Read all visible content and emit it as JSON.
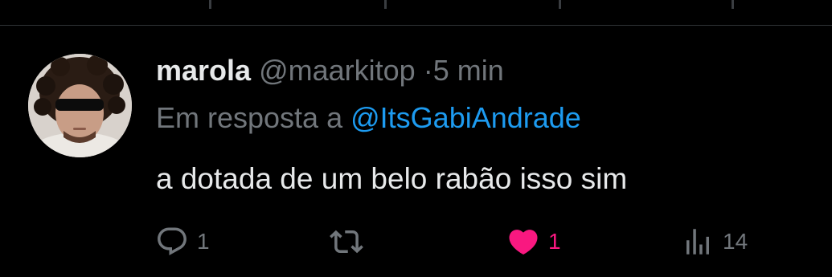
{
  "colors": {
    "background": "#000000",
    "divider": "#2f3336",
    "primary_text": "#e7e9ea",
    "secondary_text": "#71767b",
    "mention": "#1d9bf0",
    "like_active": "#f91880"
  },
  "tweet": {
    "author": {
      "display_name": "marola",
      "handle": "@maarkitop",
      "avatar_icon": "user-avatar-photo"
    },
    "separator": "·",
    "timestamp": "5 min",
    "reply_prefix": "Em resposta a",
    "reply_to": "@ItsGabiAndrade",
    "text": "a dotada de um belo rabão isso sim",
    "actions": {
      "reply": {
        "icon": "reply-icon",
        "count": "1"
      },
      "retweet": {
        "icon": "retweet-icon",
        "count": ""
      },
      "like": {
        "icon": "heart-filled-icon",
        "count": "1",
        "active": true
      },
      "views": {
        "icon": "views-icon",
        "count": "14"
      }
    }
  }
}
